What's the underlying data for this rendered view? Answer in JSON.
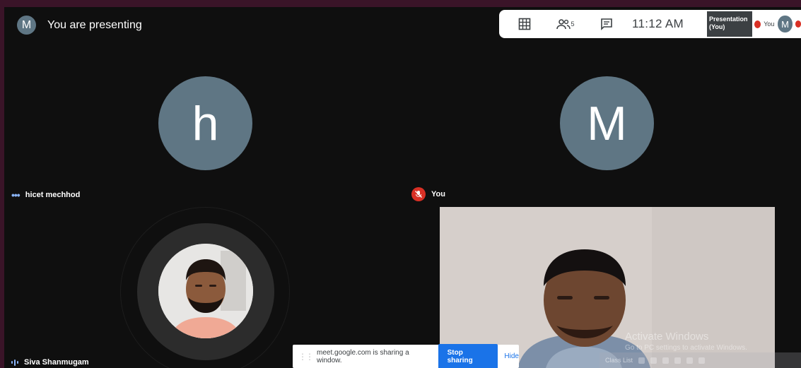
{
  "presenting": {
    "avatar_letter": "M",
    "text": "You are presenting"
  },
  "toolbar": {
    "people_count": "5",
    "time": "11:12 AM",
    "self_tile": {
      "line1": "Presentation",
      "line2": "(You)"
    },
    "self_label": "You",
    "avatar_letter": "M"
  },
  "participants": [
    {
      "name": "hicet mechhod",
      "avatar_letter": "h"
    },
    {
      "name": "You",
      "avatar_letter": "M"
    },
    {
      "name": "Siva Shanmugam"
    }
  ],
  "share_bar": {
    "message": "meet.google.com is sharing a window.",
    "stop_label": "Stop sharing",
    "hide_label": "Hide"
  },
  "watermark": {
    "line1": "Activate Windows",
    "line2": "Go to PC settings to activate Windows."
  },
  "taskbar": {
    "label": "Class List"
  },
  "colors": {
    "accent": "#1a73e8",
    "avatar": "#5f7684",
    "muted_red": "#d93025",
    "background": "#0f0f0f"
  },
  "icons": [
    "grid-icon",
    "people-icon",
    "chat-icon",
    "mic-off-icon"
  ]
}
